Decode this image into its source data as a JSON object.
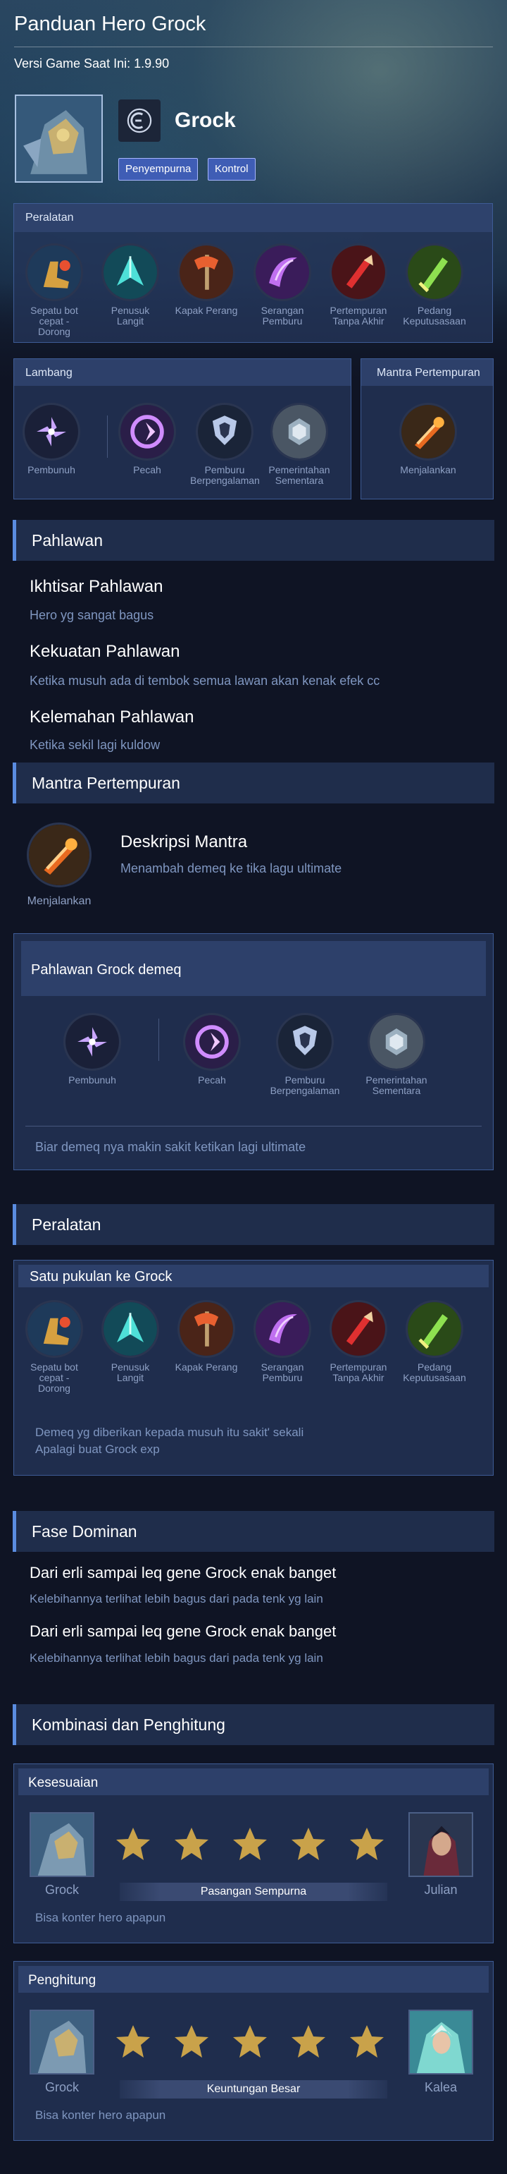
{
  "header": {
    "title": "Panduan Hero Grock",
    "version": "Versi Game Saat Ini: 1.9.90",
    "hero_name": "Grock",
    "tags": [
      "Penyempurna",
      "Kontrol"
    ]
  },
  "top_equipment": {
    "title": "Peralatan",
    "items": [
      {
        "label": "Sepatu bot cepat - Dorong",
        "icon": "boots-icon"
      },
      {
        "label": "Penusuk Langit",
        "icon": "sky-piercer-icon"
      },
      {
        "label": "Kapak Perang",
        "icon": "war-axe-icon"
      },
      {
        "label": "Serangan Pemburu",
        "icon": "hunter-strike-icon"
      },
      {
        "label": "Pertempuran Tanpa Akhir",
        "icon": "endless-battle-icon"
      },
      {
        "label": "Pedang Keputusasaan",
        "icon": "blade-of-despair-icon"
      }
    ]
  },
  "emblem_box": {
    "title": "Lambang",
    "items": [
      {
        "label": "Pembunuh"
      },
      {
        "label": "Pecah"
      },
      {
        "label": "Pemburu Berpengalaman"
      },
      {
        "label": "Pemerintahan Sementara"
      }
    ]
  },
  "spell_box": {
    "title": "Mantra Pertempuran",
    "label": "Menjalankan"
  },
  "hero_section": {
    "title": "Pahlawan",
    "overview_title": "Ikhtisar Pahlawan",
    "overview_text": "Hero yg sangat bagus",
    "strength_title": "Kekuatan Pahlawan",
    "strength_text": "Ketika musuh ada di tembok semua lawan akan kenak efek cc",
    "weakness_title": "Kelemahan Pahlawan",
    "weakness_text": "Ketika sekil lagi kuldow"
  },
  "spell_section": {
    "title": "Mantra Pertempuran",
    "icon_label": "Menjalankan",
    "desc_title": "Deskripsi Mantra",
    "desc_text": "Menambah demeq ke tika lagu ultimate"
  },
  "emblem_panel": {
    "title": "Pahlawan Grock demeq",
    "items": [
      {
        "label": "Pembunuh"
      },
      {
        "label": "Pecah"
      },
      {
        "label": "Pemburu Berpengalaman"
      },
      {
        "label": "Pemerintahan Sementara"
      }
    ],
    "note": "Biar demeq nya makin sakit ketikan lagi ultimate"
  },
  "equipment_section": {
    "title": "Peralatan",
    "panel_title": "Satu pukulan ke Grock",
    "items": [
      {
        "label": "Sepatu bot cepat - Dorong"
      },
      {
        "label": "Penusuk Langit"
      },
      {
        "label": "Kapak Perang"
      },
      {
        "label": "Serangan Pemburu"
      },
      {
        "label": "Pertempuran Tanpa Akhir"
      },
      {
        "label": "Pedang Keputusasaan"
      }
    ],
    "note_line1": "Demeq yg diberikan kepada musuh itu sakit' sekali",
    "note_line2": "Apalagi buat Grock exp"
  },
  "dominant_section": {
    "title": "Fase Dominan",
    "entries": [
      {
        "title": "Dari erli sampai leq gene Grock enak banget",
        "text": "Kelebihannya terlihat lebih bagus dari pada tenk yg lain"
      },
      {
        "title": "Dari erli sampai leq gene Grock enak banget",
        "text": "Kelebihannya terlihat lebih bagus dari pada tenk yg lain"
      }
    ]
  },
  "combo_section": {
    "title": "Kombinasi dan Penghitung",
    "compat": {
      "title": "Kesesuaian",
      "hero_left": "Grock",
      "hero_right": "Julian",
      "rating": 5,
      "rating_label": "Pasangan Sempurna",
      "note": "Bisa konter hero apapun"
    },
    "counter": {
      "title": "Penghitung",
      "hero_left": "Grock",
      "hero_right": "Kalea",
      "rating": 5,
      "rating_label": "Keuntungan Besar",
      "note": "Bisa konter hero apapun"
    }
  },
  "colors": {
    "accent": "#5a8ce0",
    "tag_bg": "#3f5db5",
    "star": "#c9a24a"
  }
}
